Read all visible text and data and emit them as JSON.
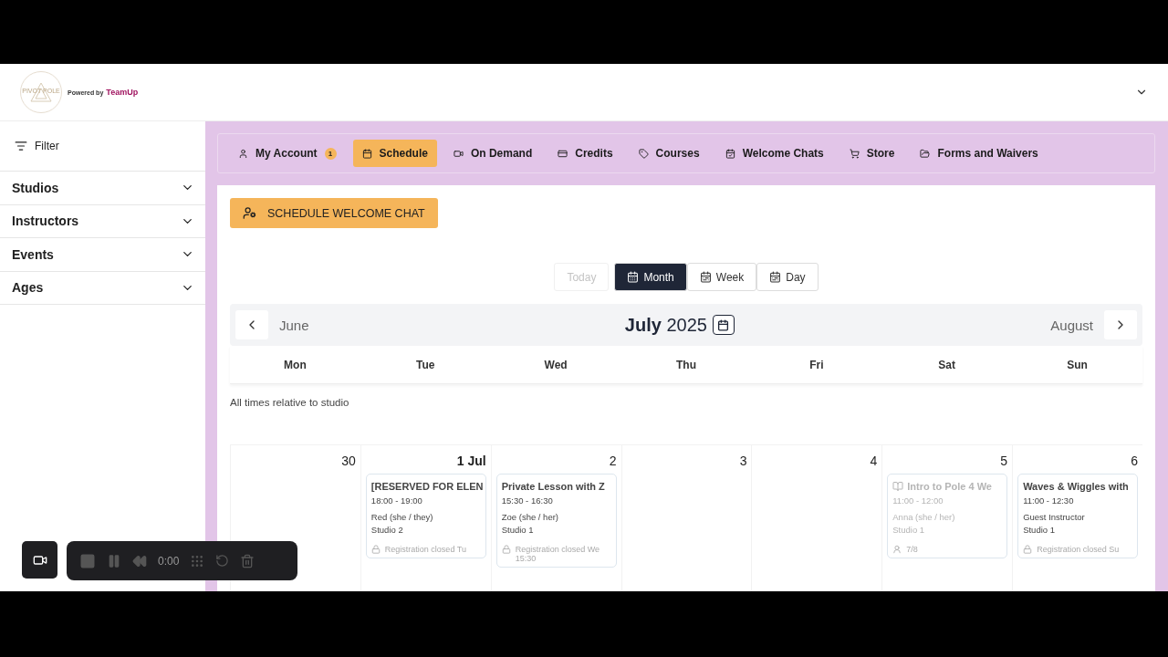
{
  "header": {
    "logo_text": "PIVOT POLE",
    "powered_by": "Powered by",
    "brand": "TeamUp"
  },
  "sidebar": {
    "filter_label": "Filter",
    "sections": [
      {
        "label": "Studios",
        "expanded": false
      },
      {
        "label": "Instructors",
        "expanded": false
      },
      {
        "label": "Events",
        "expanded": false
      },
      {
        "label": "Ages",
        "expanded": false
      }
    ]
  },
  "nav": [
    {
      "label": "My Account",
      "badge": "1",
      "selected": false
    },
    {
      "label": "Schedule",
      "selected": true
    },
    {
      "label": "On Demand",
      "selected": false
    },
    {
      "label": "Credits",
      "selected": false
    },
    {
      "label": "Courses",
      "selected": false
    },
    {
      "label": "Welcome Chats",
      "selected": false
    },
    {
      "label": "Store",
      "selected": false
    },
    {
      "label": "Forms and Waivers",
      "selected": false
    }
  ],
  "action_button": "SCHEDULE WELCOME CHAT",
  "view_buttons": [
    {
      "label": "Today",
      "disabled": true,
      "selected": false
    },
    {
      "label": "Month",
      "disabled": false,
      "selected": true
    },
    {
      "label": "Week",
      "disabled": false,
      "selected": false
    },
    {
      "label": "Day",
      "disabled": false,
      "selected": false
    }
  ],
  "month_bar": {
    "prev": "June",
    "month": "July",
    "year": "2025",
    "next": "August"
  },
  "weekdays": [
    "Mon",
    "Tue",
    "Wed",
    "Thu",
    "Fri",
    "Sat",
    "Sun"
  ],
  "timezone_note": "All times relative to studio",
  "days": [
    {
      "date": "30",
      "bold": false
    },
    {
      "date": "1 Jul",
      "bold": true,
      "events": [
        {
          "title": "[RESERVED FOR ELEN",
          "time": "18:00 - 19:00",
          "instructor": "Red (she / they)",
          "studio": "Studio 2",
          "footer": {
            "kind": "closed",
            "text": "Registration closed Tu"
          },
          "disabled": false,
          "course": false
        }
      ]
    },
    {
      "date": "2",
      "bold": false,
      "events": [
        {
          "title": "Private Lesson with Z",
          "time": "15:30 - 16:30",
          "instructor": "Zoe (she / her)",
          "studio": "Studio 1",
          "footer": {
            "kind": "closed",
            "text": "Registration closed We",
            "extra": "15:30"
          },
          "disabled": false,
          "course": false
        }
      ]
    },
    {
      "date": "3",
      "bold": false
    },
    {
      "date": "4",
      "bold": false
    },
    {
      "date": "5",
      "bold": false,
      "events": [
        {
          "title": "Intro to Pole 4 We",
          "time": "11:00 - 12:00",
          "instructor": "Anna (she / her)",
          "studio": "Studio 1",
          "footer": {
            "kind": "capacity",
            "text": "7/8"
          },
          "disabled": true,
          "course": true
        }
      ]
    },
    {
      "date": "6",
      "bold": false,
      "events": [
        {
          "title": "Waves & Wiggles with",
          "time": "11:00 - 12:30",
          "instructor": "Guest Instructor",
          "studio": "Studio 1",
          "footer": {
            "kind": "closed",
            "text": "Registration closed Su"
          },
          "disabled": false,
          "course": false
        }
      ]
    }
  ],
  "recorder": {
    "time": "0:00"
  }
}
